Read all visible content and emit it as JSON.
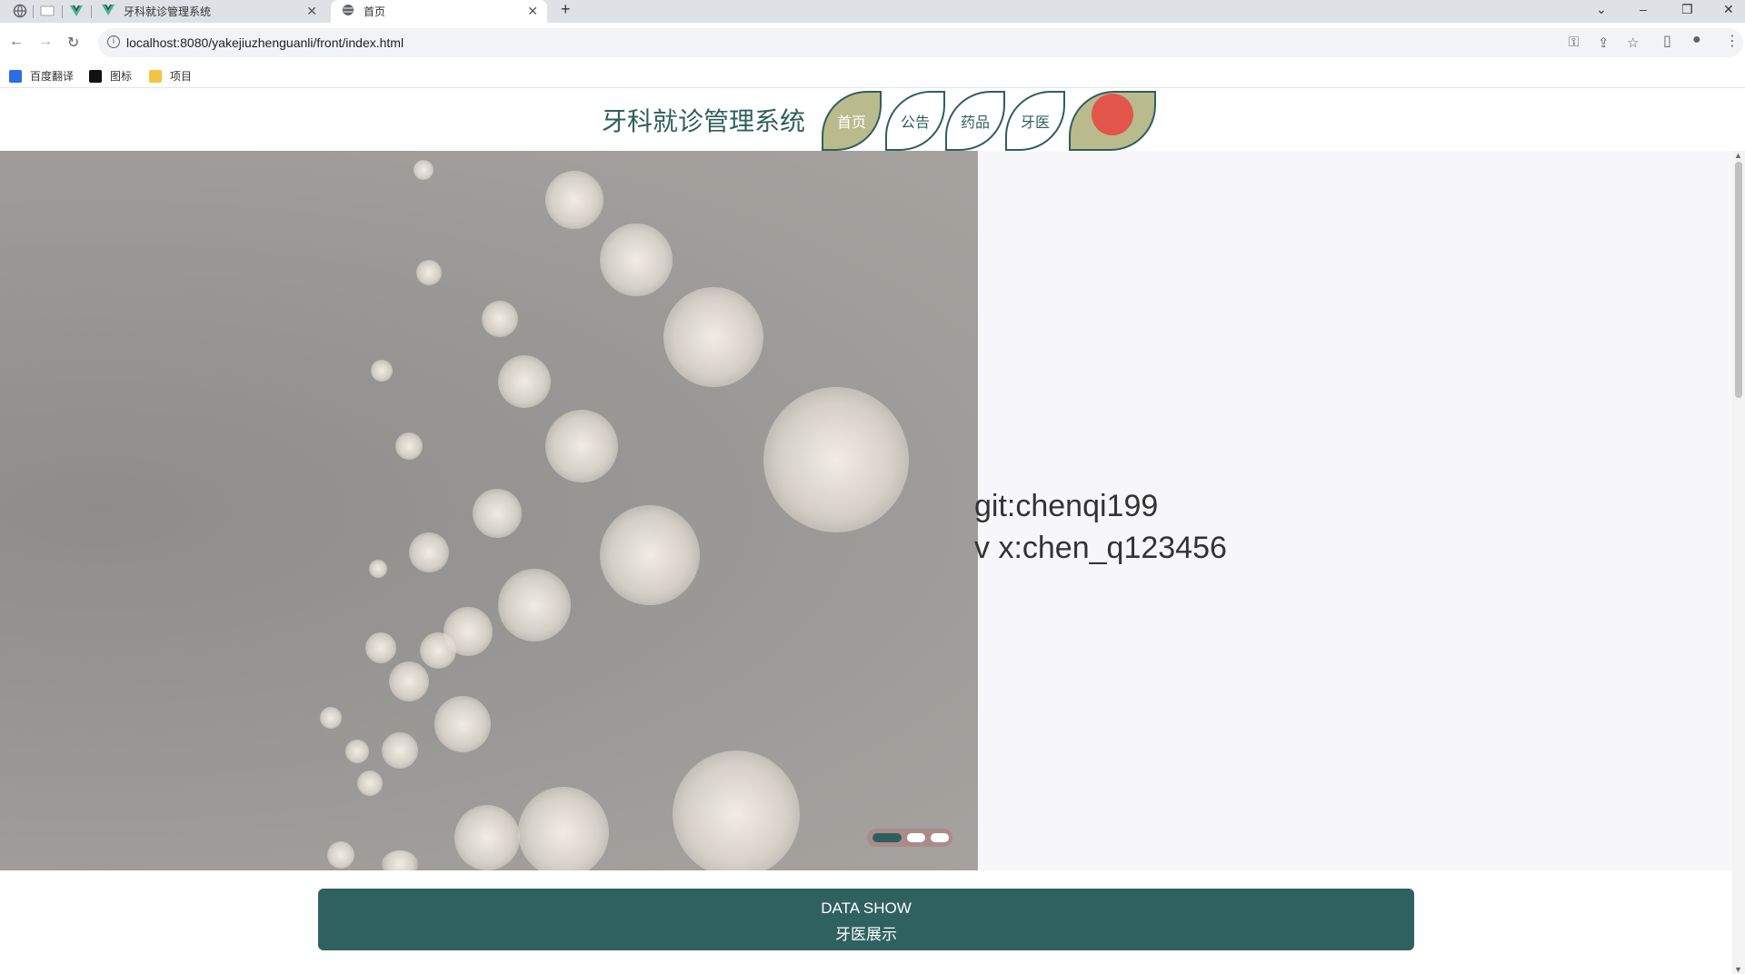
{
  "browser": {
    "tabs": [
      {
        "title": "牙科就诊管理系统",
        "active": false
      },
      {
        "title": "首页",
        "active": true
      }
    ],
    "url": "localhost:8080/yakejiuzhenguanli/front/index.html",
    "bookmarks": [
      "百度翻译",
      "图标",
      "项目"
    ]
  },
  "site": {
    "title": "牙科就诊管理系统",
    "nav": [
      "首页",
      "公告",
      "药品",
      "牙医"
    ],
    "active_nav": "首页"
  },
  "banner": {
    "lines": [
      "git:chenqi199",
      "v x:chen_q123456"
    ],
    "slides": 3,
    "active_slide": 1
  },
  "section": {
    "title_en": "DATA SHOW",
    "title_cn": "牙医展示"
  },
  "colors": {
    "brand": "#2f5f5c",
    "nav_active": "#b9bb8c",
    "section_bg": "#2e6160"
  }
}
